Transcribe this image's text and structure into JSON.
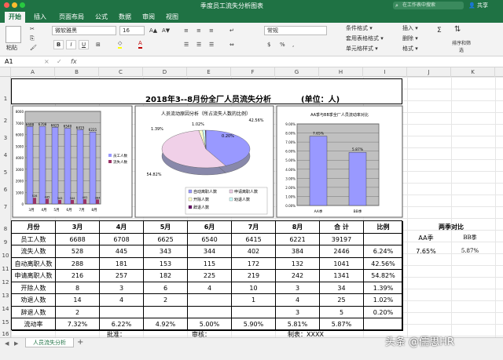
{
  "window": {
    "title": "季度员工流失分析图表",
    "search_placeholder": "在工作表中搜索",
    "share": "共享"
  },
  "tabs": [
    "开始",
    "插入",
    "页面布局",
    "公式",
    "数据",
    "审阅",
    "视图"
  ],
  "ribbon": {
    "paste": "粘贴",
    "font_name": "微软雅黑",
    "font_size": "16",
    "bold": "B",
    "italic": "I",
    "underline": "U",
    "number_format": "常规",
    "percent": "%",
    "conditional_format": "条件格式",
    "table_format": "套用表格格式",
    "cell_style": "单元格样式",
    "insert": "插入",
    "delete": "删除",
    "format": "格式",
    "sort_filter": "排序和筛选"
  },
  "formula_bar": {
    "cell_ref": "A1",
    "fx": "fx",
    "value": ""
  },
  "columns": [
    "A",
    "B",
    "C",
    "D",
    "E",
    "F",
    "G",
    "H",
    "I",
    "J",
    "K"
  ],
  "rows": [
    "1",
    "2",
    "3",
    "4",
    "5",
    "6",
    "7",
    "8",
    "9",
    "10",
    "11",
    "12",
    "13",
    "14",
    "15",
    "16",
    "17"
  ],
  "sheet_title": "2018年3--8月份全厂人员流失分析",
  "sheet_unit": "(单位：人)",
  "table": {
    "headers": [
      "月份",
      "3月",
      "4月",
      "5月",
      "6月",
      "7月",
      "8月",
      "合 计",
      "比例"
    ],
    "rows": [
      [
        "员工人数",
        "6688",
        "6708",
        "6625",
        "6540",
        "6415",
        "6221",
        "39197",
        ""
      ],
      [
        "流失人数",
        "528",
        "445",
        "343",
        "344",
        "402",
        "384",
        "2446",
        "6.24%"
      ],
      [
        "自动离职人数",
        "288",
        "181",
        "153",
        "115",
        "172",
        "132",
        "1041",
        "42.56%"
      ],
      [
        "申请离职人数",
        "216",
        "257",
        "182",
        "225",
        "219",
        "242",
        "1341",
        "54.82%"
      ],
      [
        "开除人数",
        "8",
        "3",
        "6",
        "4",
        "10",
        "3",
        "34",
        "1.39%"
      ],
      [
        "劝退人数",
        "14",
        "4",
        "2",
        "",
        "1",
        "4",
        "25",
        "1.02%"
      ],
      [
        "辞退人数",
        "2",
        "",
        "",
        "",
        "",
        "3",
        "5",
        "0.20%"
      ],
      [
        "流动率",
        "7.32%",
        "6.22%",
        "4.92%",
        "5.00%",
        "5.90%",
        "5.81%",
        "5.87%",
        ""
      ]
    ],
    "compare_title": "两季对比",
    "compare_labels": [
      "AA季",
      "BB季"
    ],
    "compare_values": [
      "7.65%",
      "5.87%"
    ]
  },
  "footer_row": {
    "approve": "批准：",
    "review": "审核：",
    "prepared": "制表：XXXX"
  },
  "sheet_tab": "人员流失分析",
  "watermark": "头条 @儒思HR",
  "chart_data": [
    {
      "type": "bar",
      "categories": [
        "3月",
        "4月",
        "5月",
        "6月",
        "7月",
        "8月"
      ],
      "series": [
        {
          "name": "员工人数",
          "values": [
            6688,
            6708,
            6625,
            6540,
            6415,
            6221
          ],
          "color": "#9999ff"
        },
        {
          "name": "流失人数",
          "values": [
            528,
            445,
            343,
            344,
            402,
            384
          ],
          "color": "#993366"
        }
      ],
      "ylim": [
        0,
        8000
      ],
      "yticks": [
        "0",
        "1000",
        "2000",
        "3000",
        "4000",
        "5000",
        "6000",
        "7000",
        "8000"
      ],
      "legend": "right"
    },
    {
      "type": "pie",
      "title": "人员流动原因分析（所占流失人数的比例）",
      "slices": [
        {
          "name": "自动离职人数",
          "value": 42.56,
          "label": "42.56%",
          "color": "#9999ff"
        },
        {
          "name": "申请离职人数",
          "value": 54.82,
          "label": "54.82%",
          "color": "#f0d0e8"
        },
        {
          "name": "开除人数",
          "value": 1.39,
          "label": "1.39%",
          "color": "#ffffcc"
        },
        {
          "name": "劝退人数",
          "value": 1.02,
          "label": "1.02%",
          "color": "#ccffff"
        },
        {
          "name": "辞退人数",
          "value": 0.2,
          "label": "0.20%",
          "color": "#660066"
        }
      ],
      "legend": "bottom"
    },
    {
      "type": "bar",
      "title": "AA季与BB季全厂人员流动率对比",
      "categories": [
        "AA季",
        "BB季"
      ],
      "values": [
        7.65,
        5.87
      ],
      "labels": [
        "7.65%",
        "5.87%"
      ],
      "ylim": [
        0,
        9
      ],
      "yticks": [
        "0.00%",
        "1.00%",
        "2.00%",
        "3.00%",
        "4.00%",
        "5.00%",
        "6.00%",
        "7.00%",
        "8.00%",
        "9.00%"
      ]
    }
  ]
}
